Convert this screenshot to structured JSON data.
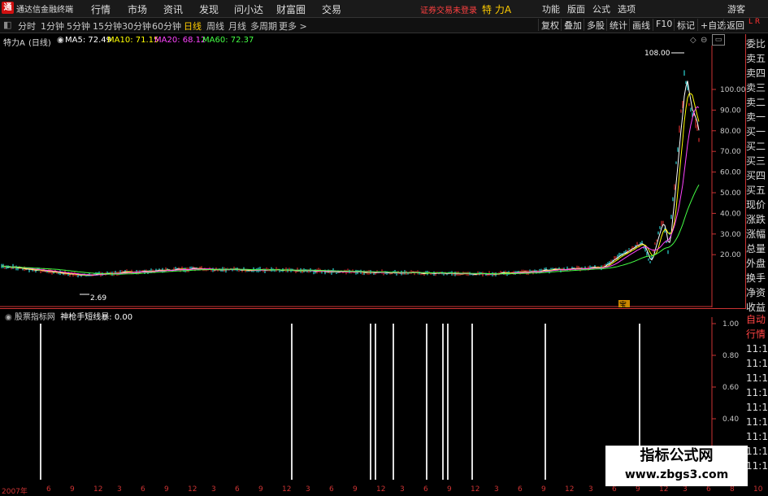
{
  "titlebar": {
    "app_name": "通达信金融终端",
    "menu": [
      "行情",
      "市场",
      "资讯",
      "发现",
      "问小达",
      "财富圈",
      "交易"
    ],
    "warning": "证券交易未登录",
    "stock": "特 力A",
    "right_menu": [
      "功能",
      "版面",
      "公式",
      "选项"
    ],
    "guest": "游客"
  },
  "toolbar": {
    "periods": [
      "分时",
      "1分钟",
      "5分钟",
      "15分钟",
      "30分钟",
      "60分钟",
      "日线",
      "周线",
      "月线",
      "多周期",
      "更多 >"
    ],
    "active": "日线",
    "right_tools": [
      "复权",
      "叠加",
      "多股",
      "统计",
      "画线",
      "F10",
      "标记",
      "+自选",
      "返回"
    ]
  },
  "price_header": {
    "stock_label": "特力A",
    "period_label": "(日线)",
    "ma5": "MA5: 72.49",
    "ma10": "MA10: 71.15",
    "ma20": "MA20: 68.12",
    "ma60": "MA60: 72.37"
  },
  "colors": {
    "ma5": "#ffffff",
    "ma10": "#ffff00",
    "ma20": "#ff44ff",
    "ma60": "#44ff44",
    "up": "#ff3333",
    "down": "#33ffff",
    "axis": "#cc3333"
  },
  "price_axis": [
    "100.00",
    "90.00",
    "80.00",
    "70.00",
    "60.00",
    "50.00",
    "40.00",
    "30.00",
    "20.00"
  ],
  "annotations": {
    "high": "108.00",
    "low": "2.69",
    "marker": "宝"
  },
  "right_panel_top": [
    "委比",
    "卖五",
    "卖四",
    "卖三",
    "卖二",
    "卖一",
    "买一",
    "买二",
    "买三",
    "买四",
    "买五",
    "现价",
    "涨跌",
    "涨幅",
    "总量",
    "外盘",
    "换手",
    "净资",
    "收益"
  ],
  "right_panel_bottom": [
    "自动",
    "行情",
    "11:1",
    "11:1",
    "11:1",
    "11:1",
    "11:1",
    "11:1",
    "11:1",
    "11:1",
    "11:1"
  ],
  "indicator": {
    "label": "股票指标网",
    "formula": "神枪手短线暴: 0.00",
    "axis": [
      "1.00",
      "0.80",
      "0.60",
      "0.40"
    ]
  },
  "x_axis": [
    "2007年",
    "6",
    "9",
    "12",
    "3",
    "6",
    "9",
    "12",
    "3",
    "6",
    "9",
    "12",
    "3",
    "6",
    "9",
    "12",
    "3",
    "6",
    "9",
    "12",
    "3",
    "6",
    "9",
    "12",
    "3",
    "6",
    "9",
    "12",
    "3",
    "6",
    "8",
    "10"
  ],
  "watermark": {
    "line1": "指标公式网",
    "line2": "www.zbgs3.com"
  }
}
